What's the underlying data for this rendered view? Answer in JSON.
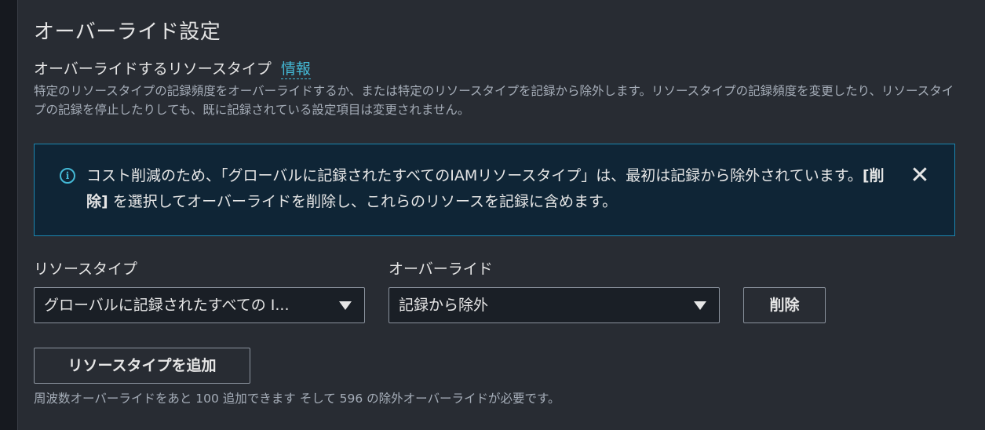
{
  "section": {
    "title": "オーバーライド設定",
    "override_label": "オーバーライドするリソースタイプ",
    "info_link": "情報",
    "description": "特定のリソースタイプの記録頻度をオーバーライドするか、または特定のリソースタイプを記録から除外します。リソースタイプの記録頻度を変更したり、リソースタイプの記録を停止したりしても、既に記録されている設定項目は変更されません。"
  },
  "alert": {
    "text_before": "コスト削減のため、「グローバルに記録されたすべてのIAMリソースタイプ」は、最初は記録から除外されています。",
    "text_bold": "[削除]",
    "text_after": " を選択してオーバーライドを削除し、これらのリソースを記録に含めます。",
    "icon": "info-icon",
    "close_icon": "close-icon"
  },
  "form": {
    "resource_type_label": "リソースタイプ",
    "resource_type_value": "グローバルに記録されたすべての I...",
    "override_label": "オーバーライド",
    "override_value": "記録から除外",
    "delete_button": "削除",
    "add_button": "リソースタイプを追加"
  },
  "footer": {
    "text": "周波数オーバーライドをあと 100 追加できます そして 596 の除外オーバーライドが必要です。"
  },
  "colors": {
    "background": "#282c33",
    "accent": "#44b9d6",
    "alert_bg": "#0f2536",
    "alert_border": "#1b86b0"
  }
}
